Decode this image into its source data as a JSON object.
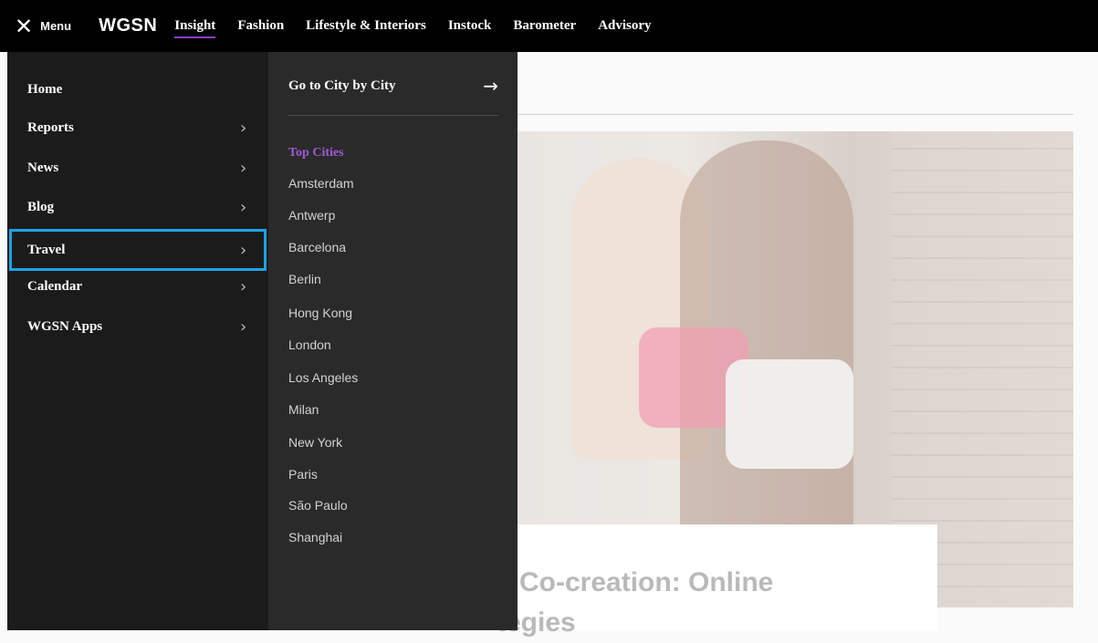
{
  "topbar": {
    "menu_label": "Menu",
    "logo": "WGSN",
    "nav": [
      "Insight",
      "Fashion",
      "Lifestyle & Interiors",
      "Instock",
      "Barometer",
      "Advisory"
    ],
    "active_nav": "Insight"
  },
  "left_menu": {
    "items": [
      {
        "label": "Home",
        "has_children": false
      },
      {
        "label": "Reports",
        "has_children": true
      },
      {
        "label": "News",
        "has_children": true
      },
      {
        "label": "Blog",
        "has_children": true
      },
      {
        "label": "Travel",
        "has_children": true,
        "selected": true
      },
      {
        "label": "Calendar",
        "has_children": true
      },
      {
        "label": "WGSN Apps",
        "has_children": true
      }
    ]
  },
  "sub_menu": {
    "goto_label": "Go to City by City",
    "section_title": "Top Cities",
    "cities": [
      "Amsterdam",
      "Antwerp",
      "Barcelona",
      "Berlin",
      "Hong Kong",
      "London",
      "Los Angeles",
      "Milan",
      "New York",
      "Paris",
      "São Paulo",
      "Shanghai"
    ]
  },
  "content": {
    "headline_line1": "il Co-creation: Online",
    "headline_line2": "tegies"
  },
  "colors": {
    "accent_purple": "#8c3ec6",
    "selection_outline": "#1aa3e6"
  }
}
